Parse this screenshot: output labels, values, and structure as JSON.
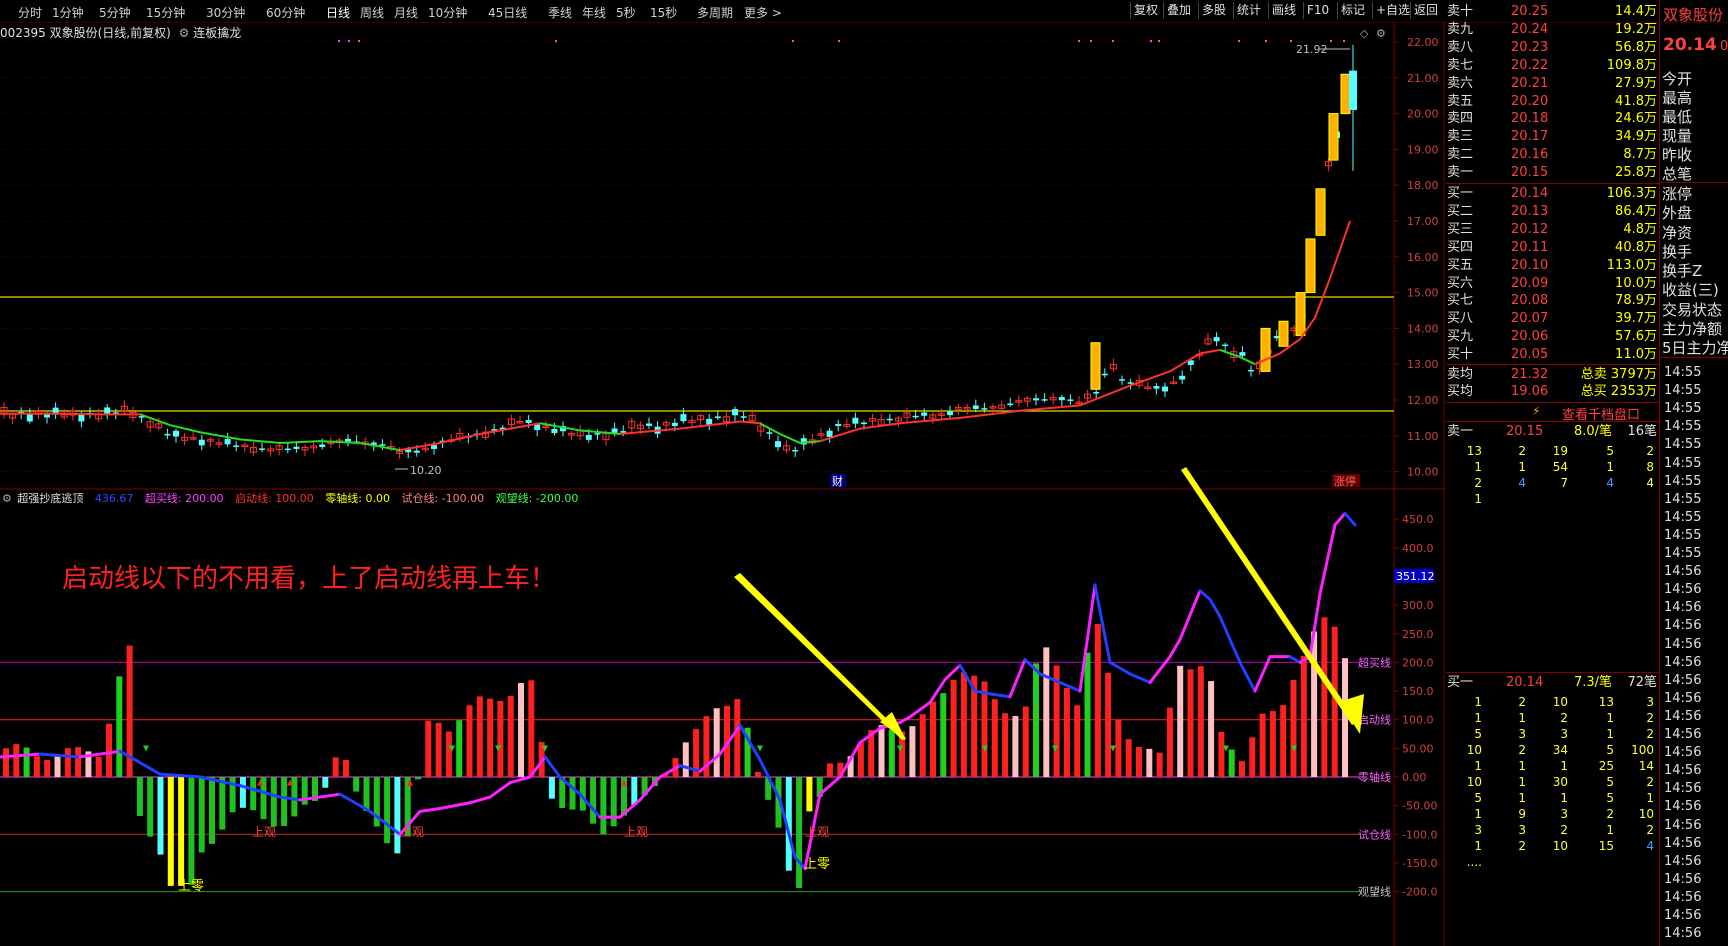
{
  "toolbar": {
    "periods": [
      "分时",
      "1分钟",
      "5分钟",
      "15分钟",
      "30分钟",
      "60分钟",
      "日线",
      "周线",
      "月线",
      "10分钟",
      "45日线",
      "季线",
      "年线",
      "5秒",
      "15秒",
      "多周期",
      "更多 >"
    ],
    "active_period": "日线",
    "actions": [
      "复权",
      "叠加",
      "多股",
      "统计",
      "画线",
      "F10",
      "标记",
      "+自选",
      "返回"
    ]
  },
  "stock": {
    "code_name": "002395 双象股份(日线,前复权)",
    "tag": "连板擒龙",
    "title_right": "双象股份",
    "last_price": "20.14",
    "last_price_suffix": "0"
  },
  "price_axis": [
    "22.00",
    "21.00",
    "20.00",
    "19.00",
    "18.00",
    "17.00",
    "16.00",
    "15.00",
    "14.00",
    "13.00",
    "12.00",
    "11.00",
    "10.00"
  ],
  "price_annotations": {
    "high": "21.92",
    "low": "10.20",
    "cai": "财",
    "zhangting": "涨停"
  },
  "indicator": {
    "name": "超强抄底逃顶",
    "value": "436.67",
    "buy_line": "超买线: 200.00",
    "start_line": "启动线: 100.00",
    "zero_line": "零轴线: 0.00",
    "test_line": "试仓线: -100.00",
    "watch_line": "观望线: -200.00",
    "axis": [
      "450.0",
      "400.0",
      "351.12",
      "300.0",
      "250.0",
      "200.0",
      "150.0",
      "100.0",
      "50.00",
      "0.00",
      "-50.00",
      "-100.0",
      "-150.0",
      "-200.0"
    ],
    "line_labels": {
      "chaomai": "超买线",
      "qidong": "启动线",
      "lingzhou": "零轴线",
      "shicang": "试仓线",
      "guanwang": "观望线"
    },
    "annotations": {
      "comment": "启动线以下的不用看，上了启动线再上车！",
      "shangling": "上零",
      "shangguan": "上观"
    }
  },
  "orderbook": {
    "sells": [
      {
        "label": "卖十",
        "price": "20.25",
        "vol": "14.4万"
      },
      {
        "label": "卖九",
        "price": "20.24",
        "vol": "19.2万"
      },
      {
        "label": "卖八",
        "price": "20.23",
        "vol": "56.8万"
      },
      {
        "label": "卖七",
        "price": "20.22",
        "vol": "109.8万"
      },
      {
        "label": "卖六",
        "price": "20.21",
        "vol": "27.9万"
      },
      {
        "label": "卖五",
        "price": "20.20",
        "vol": "41.8万"
      },
      {
        "label": "卖四",
        "price": "20.18",
        "vol": "24.6万"
      },
      {
        "label": "卖三",
        "price": "20.17",
        "vol": "34.9万"
      },
      {
        "label": "卖二",
        "price": "20.16",
        "vol": "8.7万"
      },
      {
        "label": "卖一",
        "price": "20.15",
        "vol": "25.8万"
      }
    ],
    "buys": [
      {
        "label": "买一",
        "price": "20.14",
        "vol": "106.3万"
      },
      {
        "label": "买二",
        "price": "20.13",
        "vol": "86.4万"
      },
      {
        "label": "买三",
        "price": "20.12",
        "vol": "4.8万"
      },
      {
        "label": "买四",
        "price": "20.11",
        "vol": "40.8万"
      },
      {
        "label": "买五",
        "price": "20.10",
        "vol": "113.0万"
      },
      {
        "label": "买六",
        "price": "20.09",
        "vol": "10.0万"
      },
      {
        "label": "买七",
        "price": "20.08",
        "vol": "78.9万"
      },
      {
        "label": "买八",
        "price": "20.07",
        "vol": "39.7万"
      },
      {
        "label": "买九",
        "price": "20.06",
        "vol": "57.6万"
      },
      {
        "label": "买十",
        "price": "20.05",
        "vol": "11.0万"
      }
    ],
    "avg_sell": {
      "label": "卖均",
      "price": "21.32",
      "tlabel": "总卖",
      "vol": "3797万"
    },
    "avg_buy": {
      "label": "买均",
      "price": "19.06",
      "tlabel": "总买",
      "vol": "2353万"
    },
    "qiandang": "查看千档盘口",
    "sell1_summary": {
      "label": "卖一",
      "price": "20.15",
      "per": "8.0/笔",
      "cnt": "16笔"
    },
    "sell1_queue": [
      [
        "13",
        "2",
        "19",
        "5",
        "2"
      ],
      [
        "1",
        "1",
        "54",
        "1",
        "8"
      ],
      [
        "2",
        "4",
        "7",
        "4",
        "4"
      ],
      [
        "1",
        "",
        "",
        "",
        ""
      ]
    ],
    "buy1_summary": {
      "label": "买一",
      "price": "20.14",
      "per": "7.3/笔",
      "cnt": "72笔"
    },
    "buy1_queue": [
      [
        "1",
        "2",
        "10",
        "13",
        "3"
      ],
      [
        "1",
        "1",
        "2",
        "1",
        "2"
      ],
      [
        "5",
        "3",
        "3",
        "1",
        "2"
      ],
      [
        "10",
        "2",
        "34",
        "5",
        "100"
      ],
      [
        "1",
        "1",
        "1",
        "25",
        "14"
      ],
      [
        "10",
        "1",
        "30",
        "5",
        "2"
      ],
      [
        "5",
        "1",
        "1",
        "5",
        "1"
      ],
      [
        "1",
        "9",
        "3",
        "2",
        "10"
      ],
      [
        "3",
        "3",
        "2",
        "1",
        "2"
      ],
      [
        "1",
        "2",
        "10",
        "15",
        "4"
      ],
      [
        "....",
        "",
        "",
        "",
        ""
      ]
    ]
  },
  "right_labels": [
    "今开",
    "最高",
    "最低",
    "现量",
    "昨收",
    "总笔",
    "涨停",
    "外盘",
    "净资",
    "换手",
    "换手Z",
    "收益(三)",
    "交易状态",
    "主力净额",
    "5日主力净"
  ],
  "times": [
    "14:55",
    "14:55",
    "14:55",
    "14:55",
    "14:55",
    "14:55",
    "14:55",
    "14:55",
    "14:55",
    "14:55",
    "14:55",
    "14:56",
    "14:56",
    "14:56",
    "14:56",
    "14:56",
    "14:56",
    "14:56",
    "14:56",
    "14:56",
    "14:56",
    "14:56",
    "14:56",
    "14:56",
    "14:56",
    "14:56",
    "14:56",
    "14:56",
    "14:56",
    "14:56",
    "14:56",
    "14:56"
  ]
}
